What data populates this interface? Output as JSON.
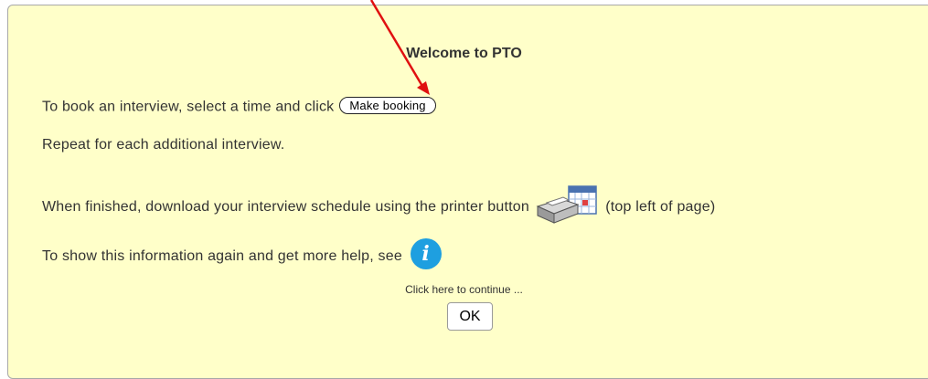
{
  "dialog": {
    "title": "Welcome to PTO",
    "line1_text": "To book an interview, select a time and click",
    "make_booking_label": "Make booking",
    "line2_text": "Repeat for each additional interview.",
    "line3_text_before": "When finished, download your interview schedule using the printer button",
    "line3_text_after": "(top left of page)",
    "line4_text": "To show this information again and get more help, see",
    "info_icon_glyph": "i",
    "continue_text": "Click here to continue ...",
    "ok_label": "OK"
  },
  "colors": {
    "dialog_background": "#ffffc9",
    "info_icon": "#1e9fe0",
    "annotation_arrow": "#e01010"
  },
  "icons": [
    "printer-calendar-icon",
    "info-icon",
    "annotation-arrow"
  ]
}
